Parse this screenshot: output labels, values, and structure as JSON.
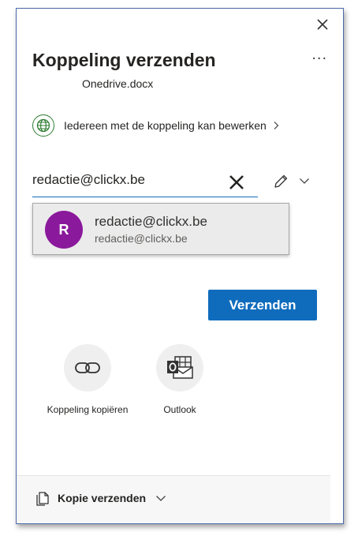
{
  "dialog": {
    "title": "Koppeling verzenden",
    "filename": "Onedrive.docx",
    "more_label": "..."
  },
  "permission": {
    "text": "Iedereen met de koppeling kan bewerken",
    "icon": "globe-icon",
    "icon_color": "#2e7d32"
  },
  "recipient": {
    "value": "redactie@clickx.be",
    "placeholder": ""
  },
  "suggestion": {
    "initial": "R",
    "name": "redactie@clickx.be",
    "email": "redactie@clickx.be",
    "avatar_color": "#8a1a9b"
  },
  "send_button": {
    "label": "Verzenden",
    "color": "#0f6cbd"
  },
  "actions": [
    {
      "label": "Koppeling kopiëren",
      "icon": "link-icon"
    },
    {
      "label": "Outlook",
      "icon": "outlook-icon"
    }
  ],
  "footer": {
    "copy_label": "Kopie verzenden",
    "icon": "copy-icon"
  }
}
